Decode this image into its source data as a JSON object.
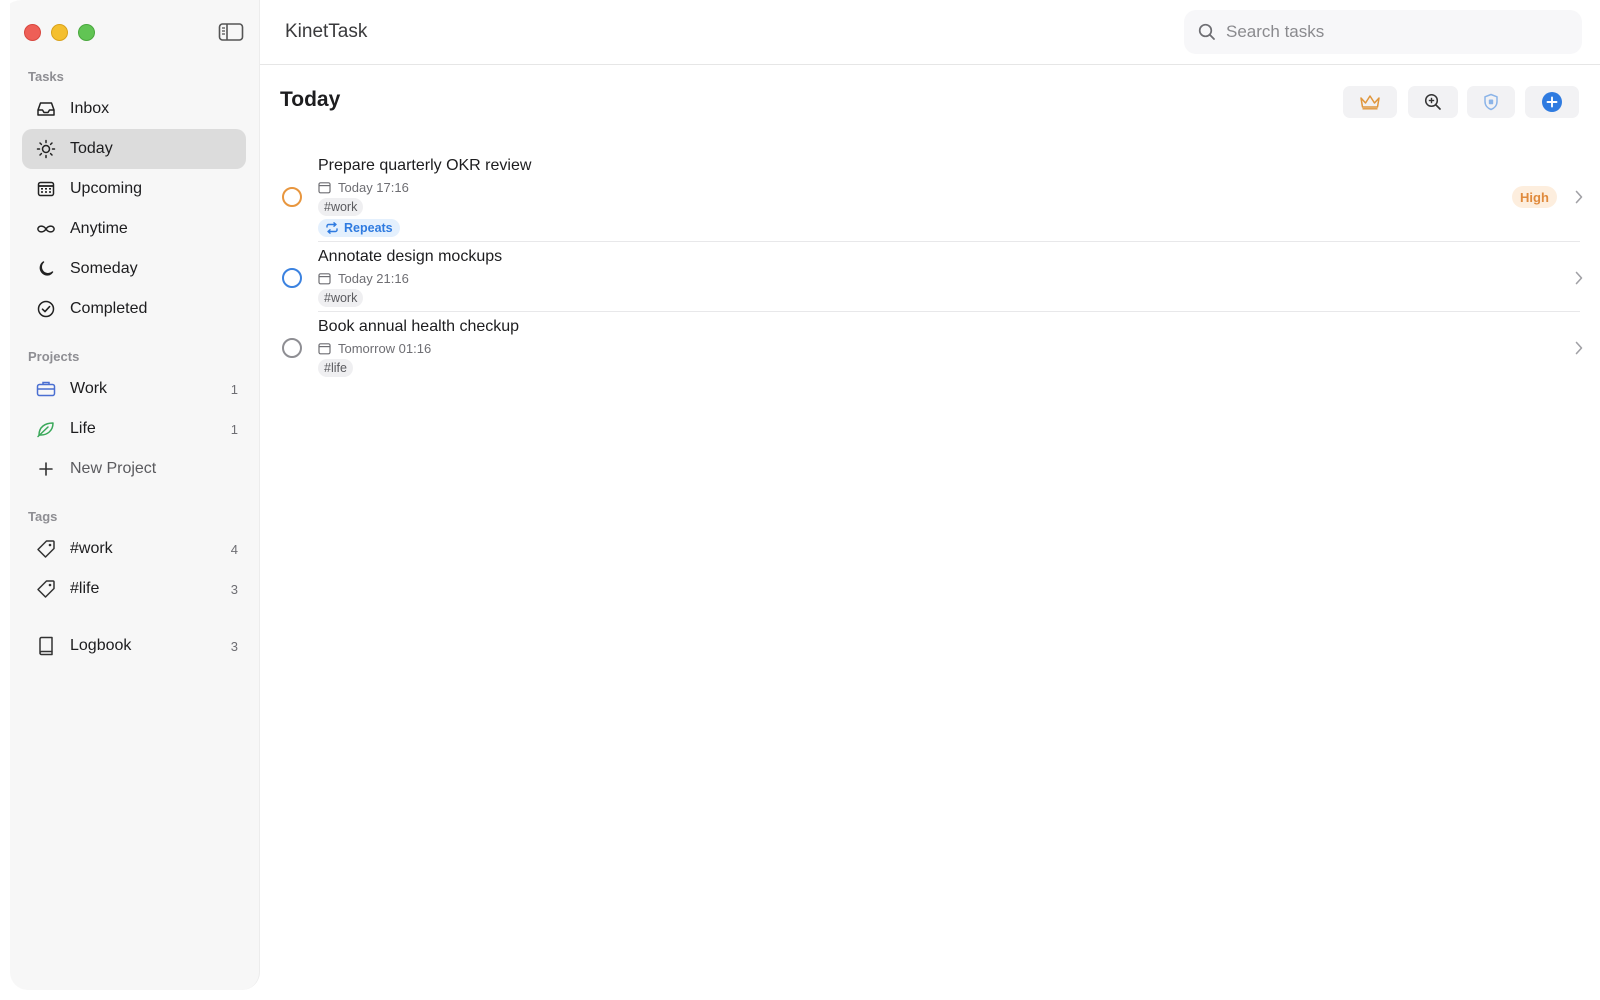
{
  "app": {
    "title": "KinetTask",
    "accent": "#2f7be0"
  },
  "search": {
    "placeholder": "Search tasks",
    "value": ""
  },
  "sidebar": {
    "sections": {
      "tasks": "Tasks",
      "projects": "Projects",
      "tags": "Tags"
    },
    "items": [
      {
        "label": "Inbox",
        "icon": "inbox-icon"
      },
      {
        "label": "Today",
        "icon": "sun-icon",
        "active": true
      },
      {
        "label": "Upcoming",
        "icon": "calendar-icon"
      },
      {
        "label": "Anytime",
        "icon": "infinity-icon"
      },
      {
        "label": "Someday",
        "icon": "moon-icon"
      },
      {
        "label": "Completed",
        "icon": "check-circle-icon"
      }
    ],
    "projects": [
      {
        "label": "Work",
        "count": "1",
        "icon": "briefcase-icon",
        "color": "#4a6fd1"
      },
      {
        "label": "Life",
        "count": "1",
        "icon": "leaf-icon",
        "color": "#3aa85a"
      }
    ],
    "new_project": "New Project",
    "tags": [
      {
        "label": "#work",
        "count": "4",
        "icon": "tag-icon"
      },
      {
        "label": "#life",
        "count": "3",
        "icon": "tag-icon"
      }
    ],
    "logbook": {
      "label": "Logbook",
      "count": "3",
      "icon": "book-icon"
    }
  },
  "main": {
    "title": "Today",
    "toolbar": [
      "crown-icon",
      "zoom-in-icon",
      "shield-icon",
      "add-circle-icon"
    ],
    "tasks": [
      {
        "title": "Prepare quarterly OKR review",
        "due": "Today 17:16",
        "tag": "#work",
        "repeat": "Repeats",
        "priority": "High",
        "check_color": "#e8963e"
      },
      {
        "title": "Annotate design mockups",
        "due": "Today 21:16",
        "tag": "#work",
        "check_color": "#3b82e0"
      },
      {
        "title": "Book annual health checkup",
        "due": "Tomorrow 01:16",
        "tag": "#life",
        "check_color": "#8e8e93"
      }
    ]
  }
}
